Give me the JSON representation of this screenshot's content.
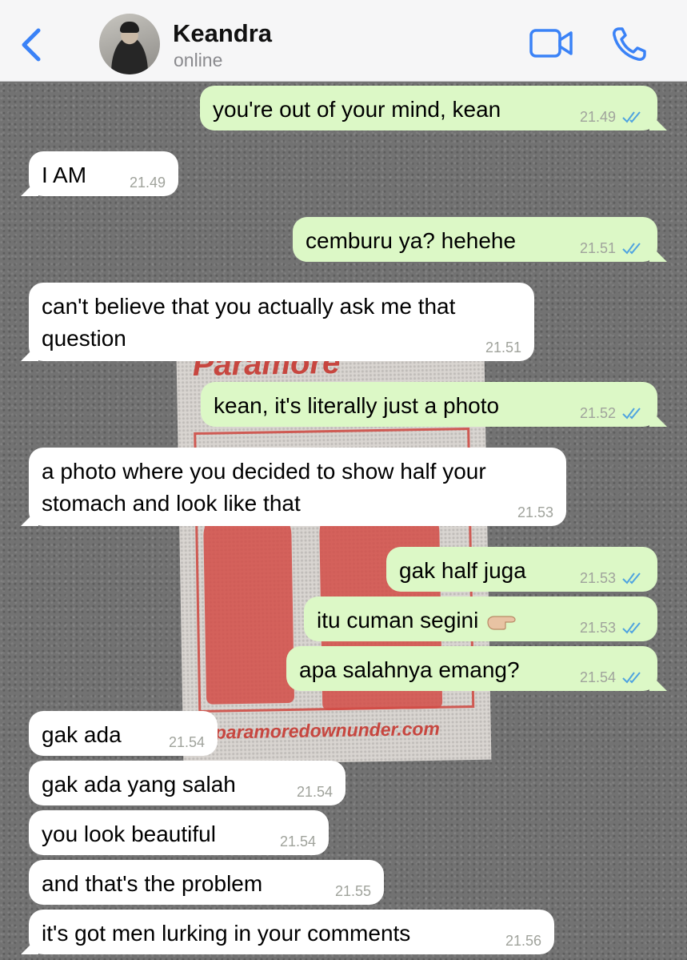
{
  "header": {
    "contact_name": "Keandra",
    "status": "online"
  },
  "colors": {
    "accent": "#3a82f7",
    "outgoing_bubble": "#dcf8c6",
    "incoming_bubble": "#ffffff",
    "read_ticks": "#4fa3e0"
  },
  "icons": {
    "back": "chevron-left-icon",
    "video": "video-camera-icon",
    "call": "phone-icon",
    "read": "double-check-icon",
    "emoji": "pointing-hand-emoji"
  },
  "wallpaper": {
    "poster_title": "Paramore",
    "poster_url": "paramoredownunder.com"
  },
  "messages": [
    {
      "direction": "out",
      "text": "you're out of your mind, kean",
      "time": "21.49"
    },
    {
      "direction": "in",
      "text": "I AM",
      "time": "21.49"
    },
    {
      "direction": "out",
      "text": "cemburu ya? hehehe",
      "time": "21.51"
    },
    {
      "direction": "in",
      "line1": "can't believe that you actually ask me that",
      "line2": "question",
      "time": "21.51"
    },
    {
      "direction": "out",
      "text": "kean, it's literally just a photo",
      "time": "21.52"
    },
    {
      "direction": "in",
      "line1": "a photo where you decided to show half your",
      "line2": "stomach and look like that",
      "time": "21.53"
    },
    {
      "direction": "out",
      "text": "gak half juga",
      "time": "21.53"
    },
    {
      "direction": "out",
      "text": "itu cuman segini",
      "time": "21.53"
    },
    {
      "direction": "out",
      "text": "apa salahnya emang?",
      "time": "21.54"
    },
    {
      "direction": "in",
      "text": "gak ada",
      "time": "21.54"
    },
    {
      "direction": "in",
      "text": "gak ada yang salah",
      "time": "21.54"
    },
    {
      "direction": "in",
      "text": "you look beautiful",
      "time": "21.54"
    },
    {
      "direction": "in",
      "text": "and that's the problem",
      "time": "21.55"
    },
    {
      "direction": "in",
      "text": "it's got men lurking in your comments",
      "time": "21.56"
    }
  ]
}
